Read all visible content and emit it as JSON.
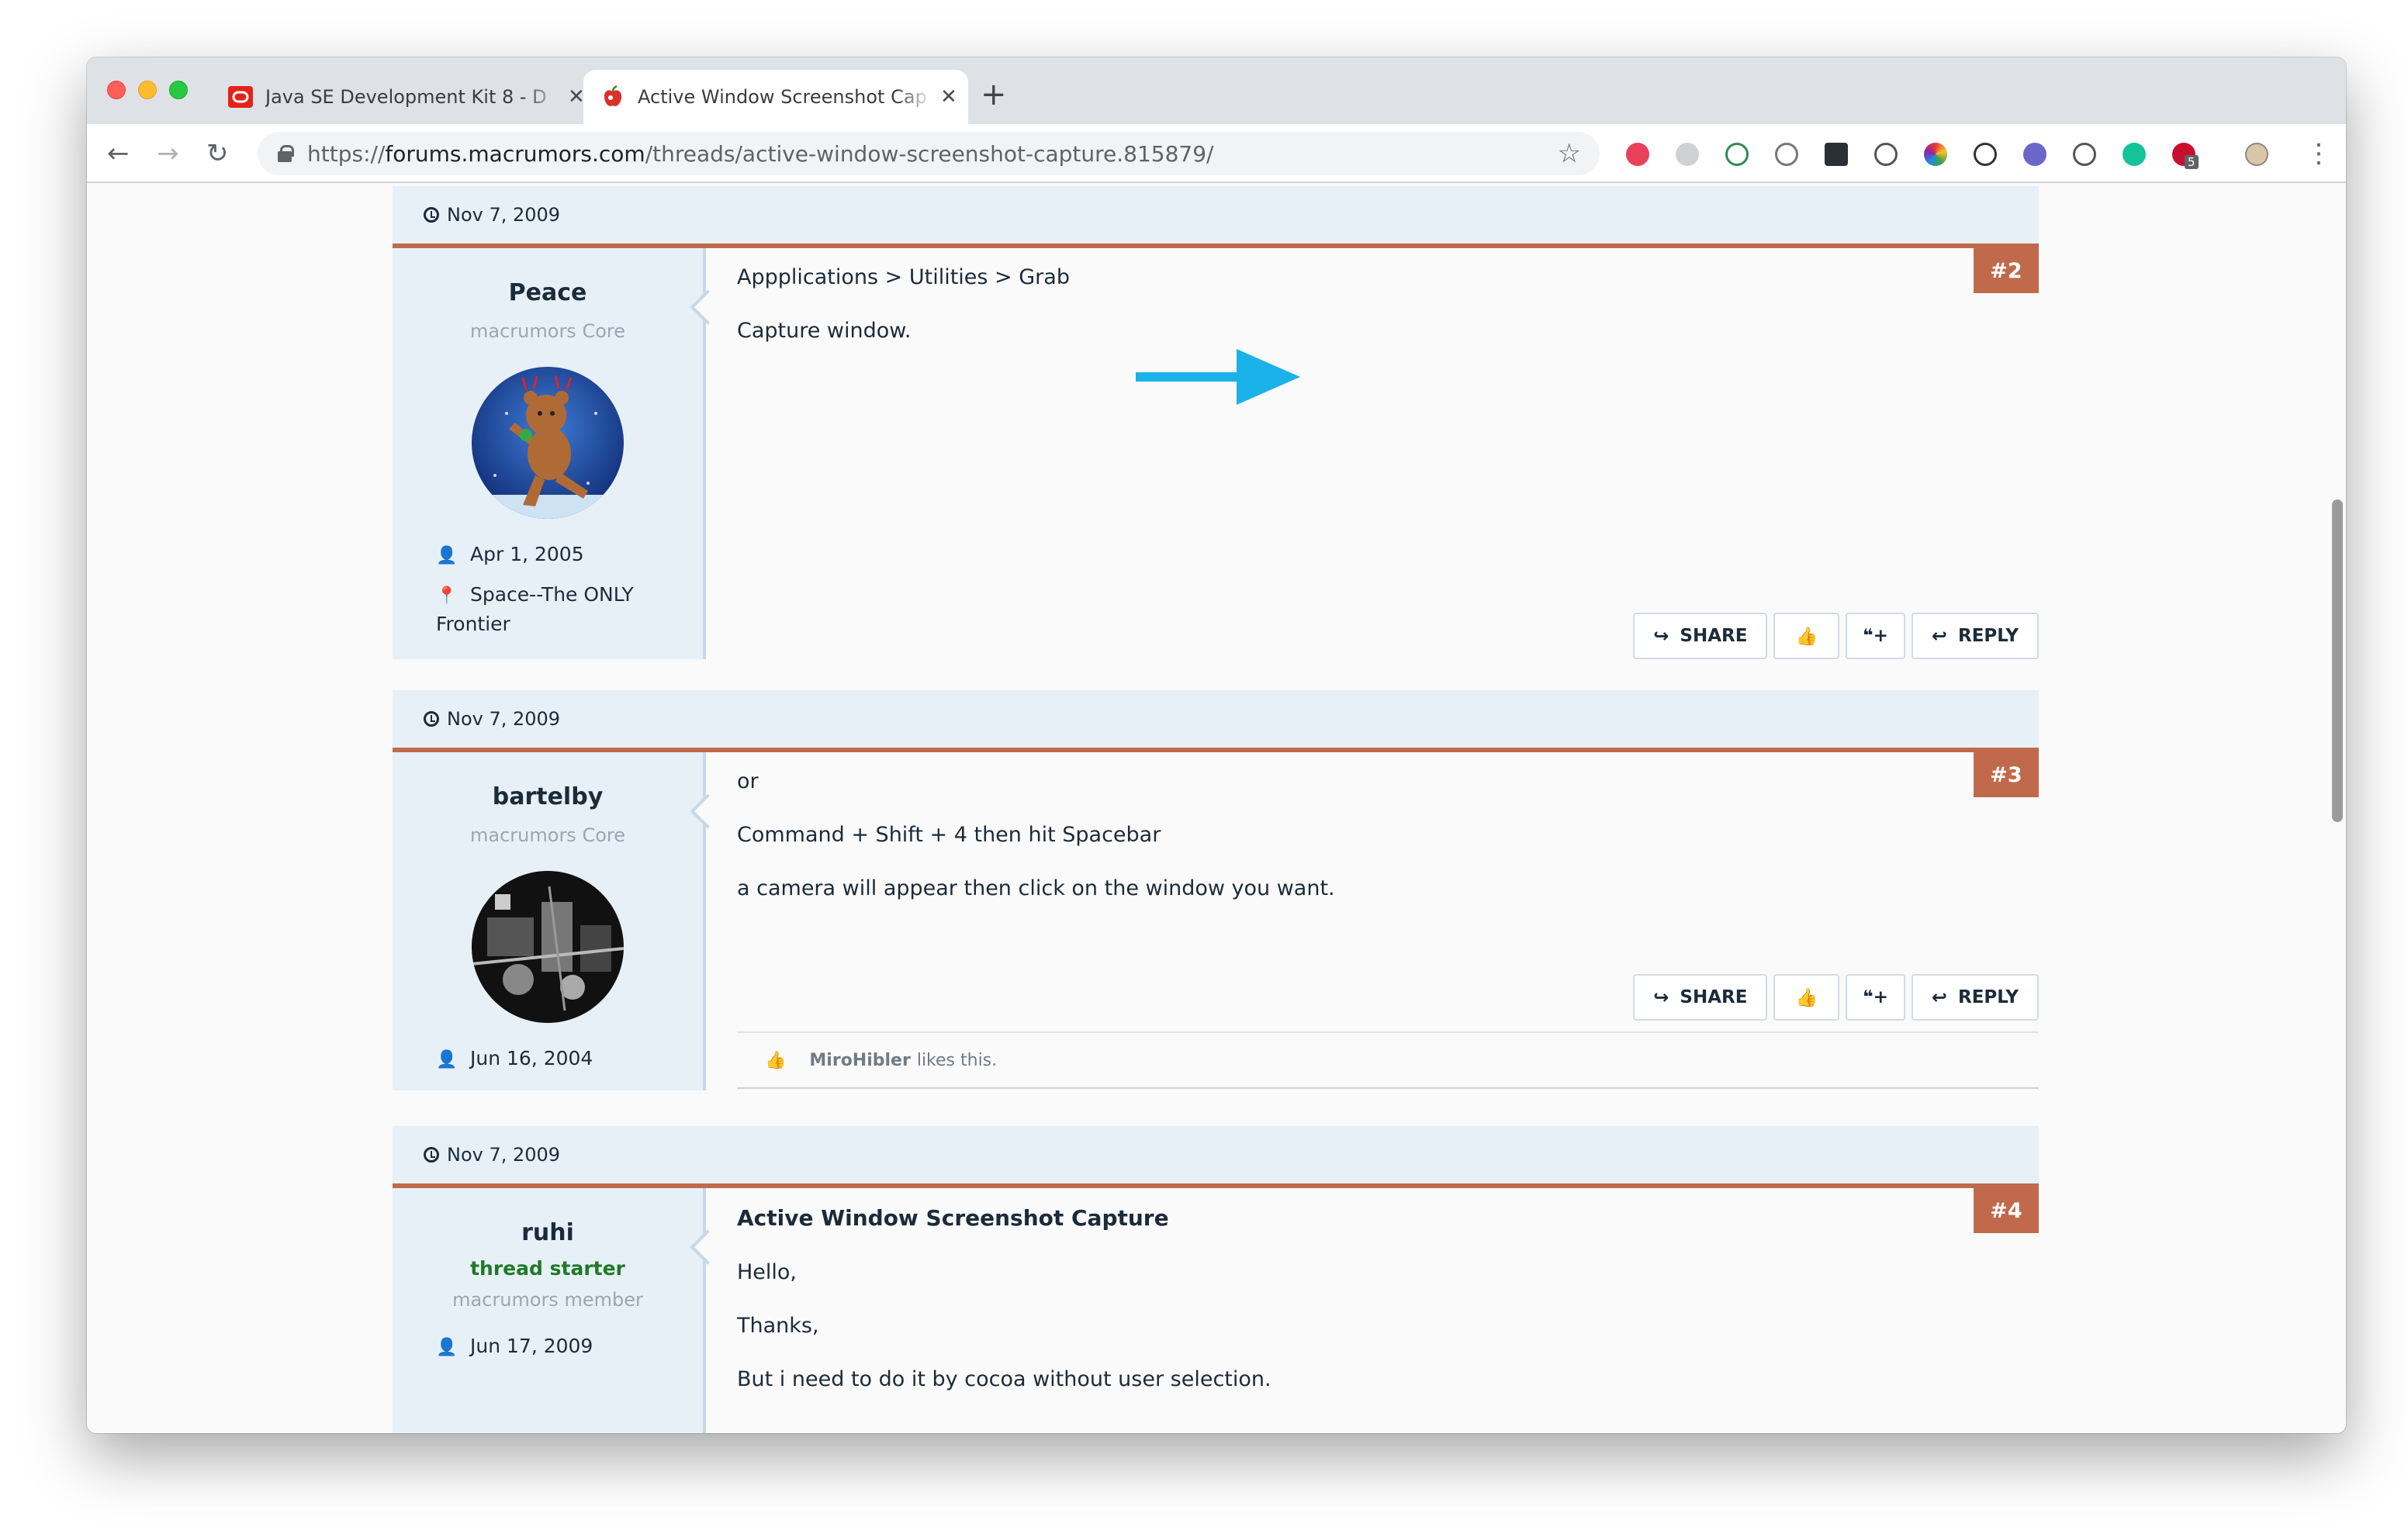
{
  "browser": {
    "tabs": [
      {
        "title": "Java SE Development Kit 8 - D",
        "active": false,
        "favicon": "oracle-icon"
      },
      {
        "title": "Active Window Screenshot Cap",
        "active": true,
        "favicon": "macrumors-apple-icon"
      }
    ],
    "new_tab_label": "+",
    "url_scheme": "https://",
    "url_host": "forums.macrumors.com",
    "url_path": "/threads/active-window-screenshot-capture.815879/",
    "extensions": [
      "t-icon",
      "hex-icon",
      "b-icon",
      "paint-icon",
      "dots-icon",
      "sign-icon",
      "color-wheel-icon",
      "sync-icon",
      "globe-icon",
      "code-icon",
      "grammarly-icon",
      "adblock-icon",
      "profile-avatar"
    ],
    "adblock_badge": "5"
  },
  "posts": [
    {
      "date": "Nov 7, 2009",
      "number": "#2",
      "user": {
        "name": "Peace",
        "role": "macrumors Core",
        "joined": "Apr 1, 2005",
        "location": "Space--The ONLY Frontier"
      },
      "body": [
        "Appplications > Utilities > Grab",
        "Capture window."
      ]
    },
    {
      "date": "Nov 7, 2009",
      "number": "#3",
      "user": {
        "name": "bartelby",
        "role": "macrumors Core",
        "joined": "Jun 16, 2004"
      },
      "body": [
        "or",
        "Command + Shift + 4 then hit Spacebar",
        "a camera will appear then click on the window you want."
      ],
      "likes": {
        "who": "MiroHibler",
        "text": "likes this."
      }
    },
    {
      "date": "Nov 7, 2009",
      "number": "#4",
      "user": {
        "name": "ruhi",
        "starter": "thread starter",
        "role": "macrumors member",
        "joined": "Jun 17, 2009"
      },
      "title": "Active Window Screenshot Capture",
      "body": [
        "Hello,",
        "Thanks,",
        "But i need to do it by cocoa without user selection."
      ]
    }
  ],
  "actions": {
    "share": "SHARE",
    "reply": "REPLY",
    "quote": "+"
  },
  "colors": {
    "accent": "#c06a4b",
    "panel": "#e8f0f7",
    "annotation_arrow": "#1ab2e8"
  }
}
